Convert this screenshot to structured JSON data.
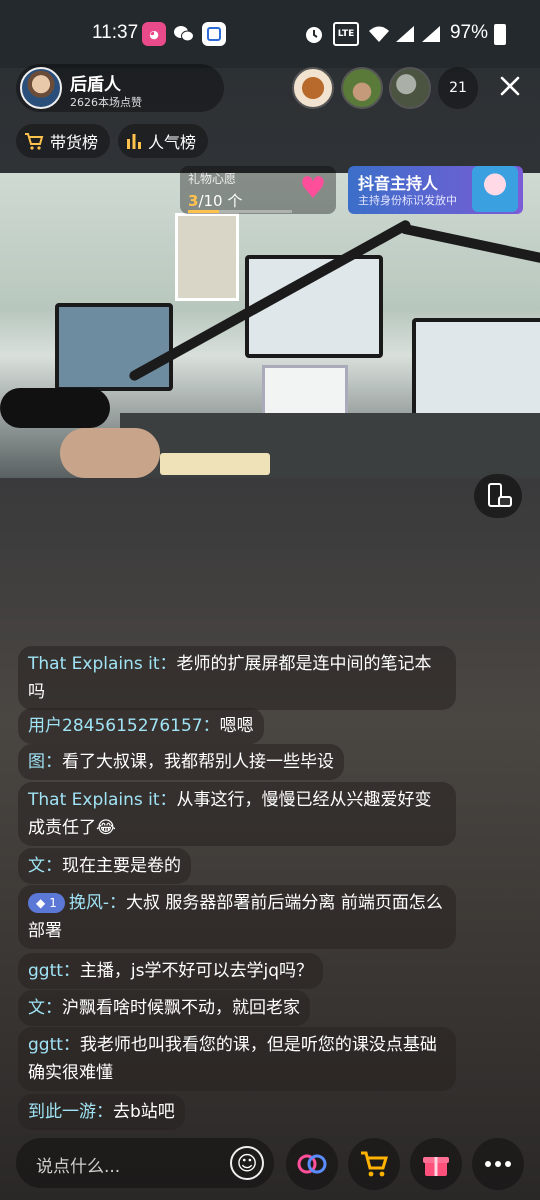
{
  "status_bar": {
    "time": "11:37",
    "battery": "97%",
    "icons": [
      "app-badge-icon",
      "wechat-icon",
      "app-icon",
      "alarm-icon",
      "volte-icon",
      "wifi-icon",
      "signal-5g-icon",
      "signal-3g-icon",
      "battery-icon"
    ]
  },
  "host": {
    "name": "后盾人",
    "likes": "2626本场点赞"
  },
  "viewers": {
    "count": "21"
  },
  "pills": {
    "sales_rank": "带货榜",
    "popularity_rank": "人气榜"
  },
  "wish": {
    "title": "礼物心愿",
    "current": "3",
    "total": "/10 个",
    "progress_fraction": 0.3
  },
  "host_badge": {
    "title": "抖音主持人",
    "subtitle": "主持身份标识发放中"
  },
  "comments": [
    {
      "user": "That Explains it：",
      "text": "老师的扩展屏都是连中间的笔记本吗"
    },
    {
      "user": "用户2845615276157：",
      "text": "嗯嗯"
    },
    {
      "user": "图：",
      "text": "看了大叔课，我都帮别人接一些毕设"
    },
    {
      "user": "That Explains it：",
      "text": "从事这行，慢慢已经从兴趣爱好变成责任了😂"
    },
    {
      "user": "文：",
      "text": "现在主要是卷的"
    },
    {
      "level": "1",
      "user": "挽风-：",
      "text": "大叔 服务器部署前后端分离 前端页面怎么部署"
    },
    {
      "user": "ggtt：",
      "text": "主播，js学不好可以去学jq吗？"
    },
    {
      "user": "文：",
      "text": "沪飘看啥时候飘不动，就回老家"
    },
    {
      "user": "ggtt：",
      "text": "我老师也叫我看您的课，但是听您的课没点基础确实很难懂"
    },
    {
      "user": "到此一游：",
      "text": "去b站吧"
    }
  ],
  "input": {
    "placeholder": "说点什么..."
  },
  "colors": {
    "username": "#9fe3f5",
    "wish_accent": "#ffc24d",
    "gift": "#ff4f7b",
    "cart": "#ffb300"
  }
}
